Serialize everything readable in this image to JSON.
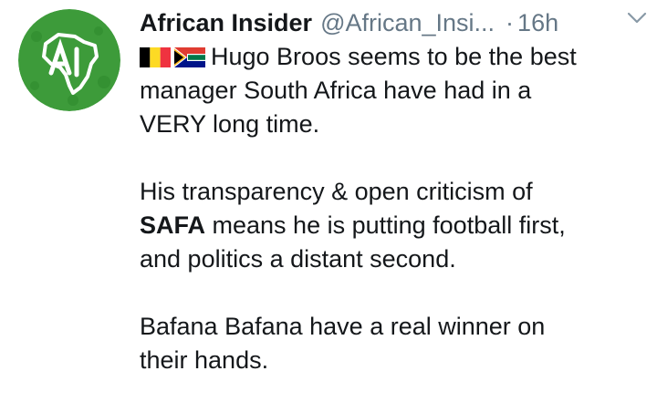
{
  "author": {
    "display_name": "African Insider",
    "handle": "@African_Insi...",
    "separator": "·",
    "time": "16h"
  },
  "avatar": {
    "letters": "AI",
    "colors": {
      "background": "#3a9a3a",
      "map": "#ffffff"
    }
  },
  "icons": {
    "menu": "chevron-down-icon",
    "flags": [
      "belgium-flag-icon",
      "south-africa-flag-icon"
    ]
  },
  "tweet": {
    "line1": "Hugo Broos seems to be the best",
    "line2": "manager South Africa have had in a",
    "line3": "VERY long time.",
    "p2_line1": "His transparency & open criticism of",
    "p2_bold": "SAFA",
    "p2_line2_rest": " means he is putting football first,",
    "p2_line3": "and politics a distant second.",
    "p3_line1": "Bafana Bafana have a real winner on",
    "p3_line2": "their hands."
  }
}
